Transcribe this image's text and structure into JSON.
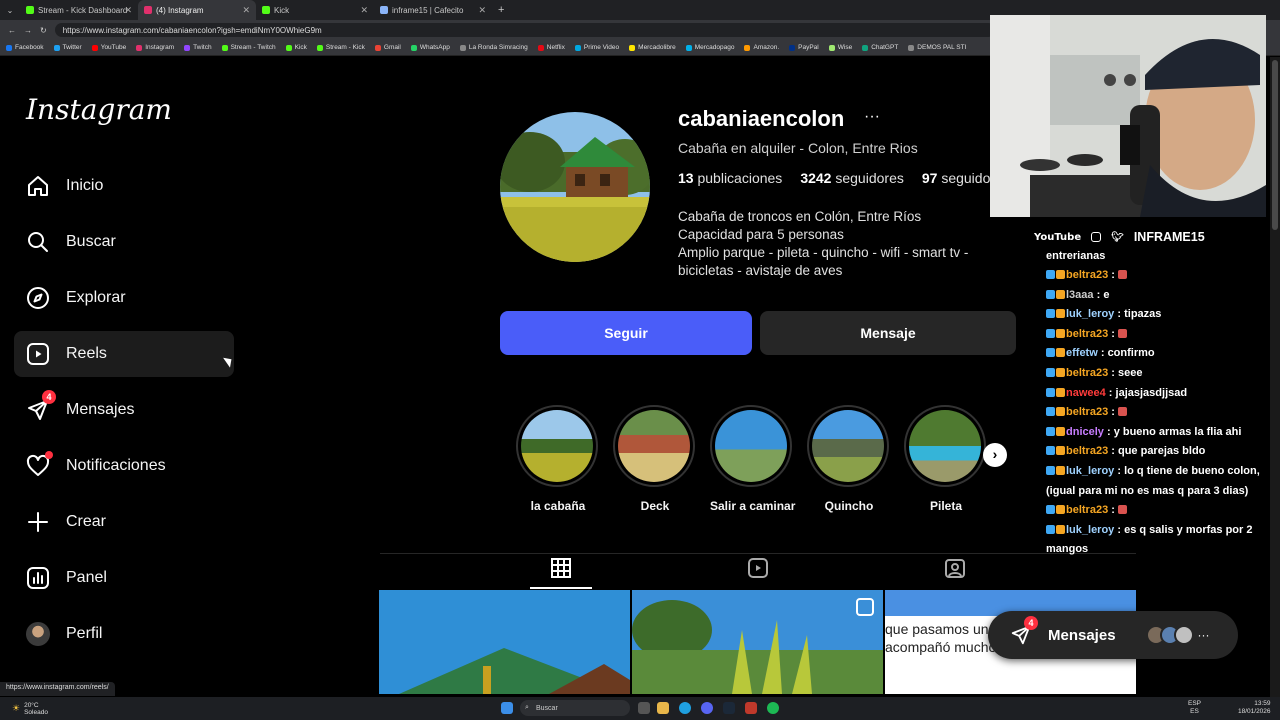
{
  "browser": {
    "tabs": [
      {
        "title": "Stream - Kick Dashboard",
        "color": "#53fc18"
      },
      {
        "title": "(4) Instagram",
        "color": "#e1306c"
      },
      {
        "title": "Kick",
        "color": "#53fc18"
      },
      {
        "title": "inframe15 | Cafecito",
        "color": "#8ab4f8"
      }
    ],
    "url": "https://www.instagram.com/cabaniaencolon?igsh=emdiNmY0OWhieG9m",
    "bookmarks": [
      "Facebook",
      "Twitter",
      "YouTube",
      "Instagram",
      "Twitch",
      "Stream - Twitch",
      "Kick",
      "Stream - Kick",
      "Gmail",
      "WhatsApp",
      "La Ronda Simracing",
      "Netflix",
      "Prime Video",
      "Mercadolibre",
      "Mercadopago",
      "Amazon.",
      "PayPal",
      "Wise",
      "ChatGPT",
      "DEMOS PAL STI"
    ]
  },
  "sidebar": {
    "logo": "Instagram",
    "items": [
      {
        "label": "Inicio"
      },
      {
        "label": "Buscar"
      },
      {
        "label": "Explorar"
      },
      {
        "label": "Reels"
      },
      {
        "label": "Mensajes",
        "badge": "4"
      },
      {
        "label": "Notificaciones"
      },
      {
        "label": "Crear"
      },
      {
        "label": "Panel"
      },
      {
        "label": "Perfil"
      }
    ]
  },
  "profile": {
    "username": "cabaniaencolon",
    "subtitle": "Cabaña en alquiler - Colon, Entre Rios",
    "posts_count": "13",
    "posts_label": "publicaciones",
    "followers_count": "3242",
    "followers_label": "seguidores",
    "following_count": "97",
    "following_label": "seguidos",
    "bio": [
      "Cabaña de troncos en Colón, Entre Ríos",
      "Capacidad para 5 personas",
      "Amplio parque - pileta - quincho - wifi - smart tv -",
      "bicicletas - avistaje de aves"
    ],
    "follow_label": "Seguir",
    "message_label": "Mensaje",
    "highlights": [
      "la cabaña",
      "Deck",
      "Salir a caminar",
      "Quincho",
      "Pileta"
    ],
    "post_caption": "que pasamos unos días hermosos. Nos acompañó mucho el clima. Lo"
  },
  "overlay": {
    "social_youtube": "YouTube",
    "social_name": "INFRAME15",
    "chat_partial": "entrerianas",
    "chat": [
      {
        "user": "beltra23",
        "msg": "",
        "color": "#f5a623"
      },
      {
        "user": "l3aaa",
        "msg": "e",
        "color": "#cccccc"
      },
      {
        "user": "luk_leroy",
        "msg": "tipazas",
        "color": "#9fd2ff"
      },
      {
        "user": "beltra23",
        "msg": "",
        "color": "#f5a623"
      },
      {
        "user": "effetw",
        "msg": "confirmo",
        "color": "#9fd2ff"
      },
      {
        "user": "beltra23",
        "msg": "seee",
        "color": "#f5a623"
      },
      {
        "user": "nawee4",
        "msg": "jajasjasdjjsad",
        "color": "#ff3b3b"
      },
      {
        "user": "beltra23",
        "msg": "",
        "color": "#f5a623"
      },
      {
        "user": "dnicely",
        "msg": "y bueno armas la flia ahi",
        "color": "#c77dff"
      },
      {
        "user": "beltra23",
        "msg": "que parejas bldo",
        "color": "#f5a623"
      },
      {
        "user": "luk_leroy",
        "msg": "lo q tiene de bueno colon, (igual para mi no es mas q para 3 dias)",
        "color": "#9fd2ff"
      },
      {
        "user": "beltra23",
        "msg": "",
        "color": "#f5a623"
      },
      {
        "user": "luk_leroy",
        "msg": "es q salis y morfas por 2 mangos",
        "color": "#9fd2ff"
      }
    ]
  },
  "messages_pill": {
    "label": "Mensajes",
    "badge": "4"
  },
  "status_url": "https://www.instagram.com/reels/",
  "taskbar": {
    "weather_temp": "20°C",
    "weather_desc": "Soleado",
    "search": "Buscar",
    "lang1": "ESP",
    "lang2": "ES",
    "time": "13:59",
    "date": "18/01/2026"
  },
  "colors": {
    "follow_button": "#4a5df9",
    "badge": "#ff3040"
  }
}
